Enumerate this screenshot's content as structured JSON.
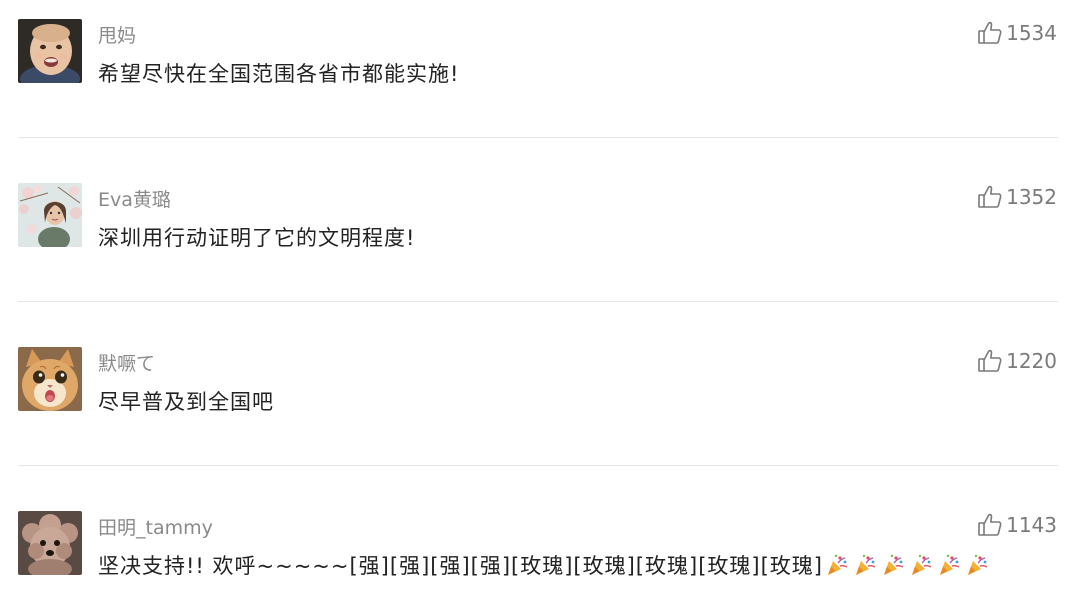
{
  "comments": [
    {
      "username": "甩妈",
      "text": "希望尽快在全国范围各省市都能实施!",
      "likes": "1534",
      "avatar_icon": "baby-photo-avatar"
    },
    {
      "username": "Eva黄璐",
      "text": "深圳用行动证明了它的文明程度!",
      "likes": "1352",
      "avatar_icon": "woman-blossoms-avatar"
    },
    {
      "username": "默噘て",
      "text": "尽早普及到全国吧",
      "likes": "1220",
      "avatar_icon": "cat-avatar"
    },
    {
      "username": "田明_tammy",
      "text": "坚决支持!! 欢呼~~~~~[强][强][强][强][玫瑰][玫瑰][玫瑰][玫瑰][玫瑰]",
      "likes": "1143",
      "avatar_icon": "poodle-avatar",
      "emoji_icon": "party-popper-icon",
      "emoji_count": 6
    }
  ],
  "colors": {
    "username": "#8a8a8a",
    "text": "#222222",
    "like": "#7a7a7a",
    "divider": "#e6e6e6",
    "background": "#ffffff"
  }
}
